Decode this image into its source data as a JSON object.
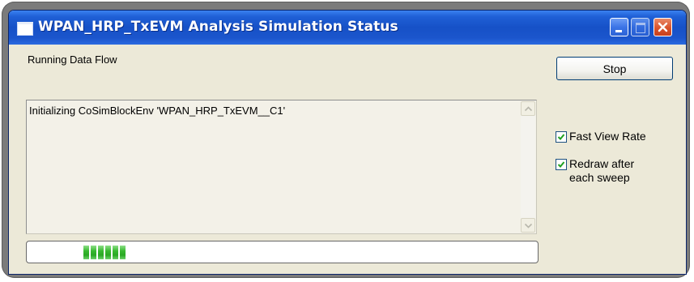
{
  "window": {
    "title": "WPAN_HRP_TxEVM Analysis Simulation Status",
    "controls": [
      "minimize",
      "maximize",
      "close"
    ]
  },
  "status": {
    "label": "Running Data Flow"
  },
  "buttons": {
    "stop_label": "Stop"
  },
  "log": {
    "lines": [
      "Initializing CoSimBlockEnv 'WPAN_HRP_TxEVM__C1'"
    ]
  },
  "options": {
    "fast_view_rate": {
      "label": "Fast View Rate",
      "checked": true
    },
    "redraw_after_each_sweep": {
      "label": "Redraw after each sweep",
      "checked": true
    }
  },
  "progress": {
    "style": "marquee",
    "active_blocks": 6
  },
  "colors": {
    "titlebar": "#1651c7",
    "window_bg": "#ece9d8",
    "progress_fill": "#37b82f",
    "close_button": "#d9532c"
  },
  "icons": {
    "window": "app-window-icon",
    "minimize": "minimize-icon",
    "maximize": "maximize-icon",
    "close": "close-icon",
    "scroll_up": "chevron-up-icon",
    "scroll_down": "chevron-down-icon",
    "check": "checkmark-icon"
  }
}
